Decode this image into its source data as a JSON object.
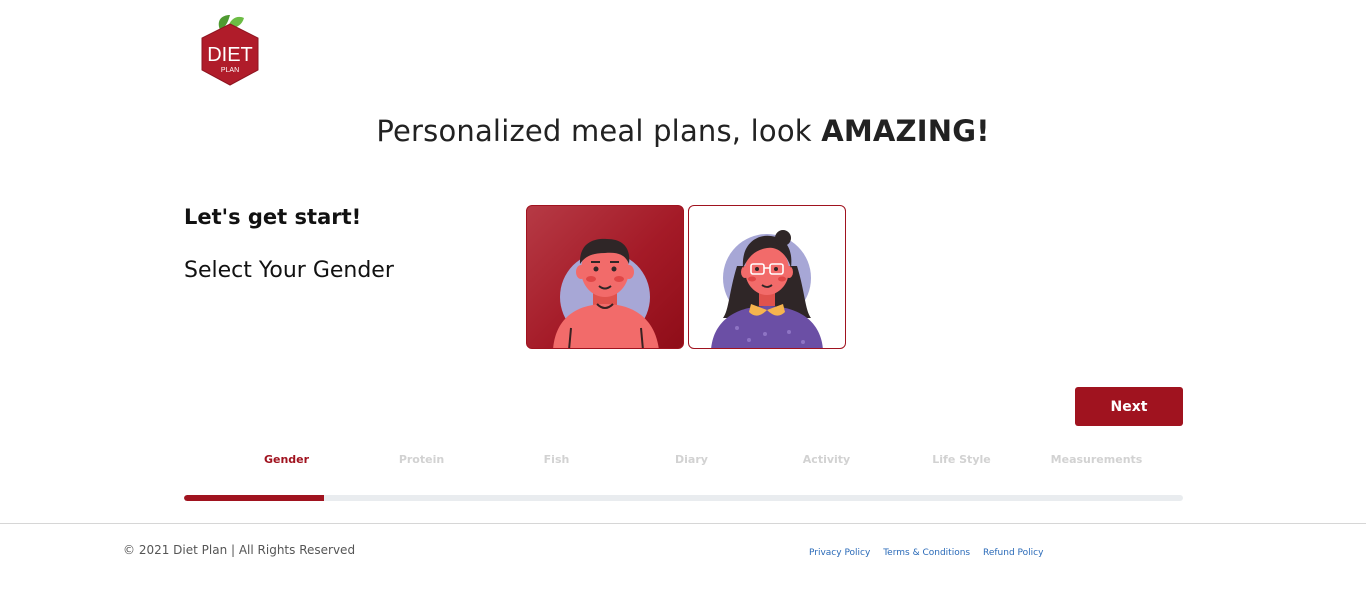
{
  "brand": {
    "logo_line1": "DIET",
    "logo_line2": "PLAN",
    "logo_color": "#b01c2a",
    "leaf_color": "#5cab3a"
  },
  "hero": {
    "title_regular": "Personalized meal plans, look ",
    "title_bold": "AMAZING!"
  },
  "intro": {
    "lead": "Let's get start!",
    "prompt": "Select Your Gender"
  },
  "gender_options": [
    {
      "id": "male",
      "avatar_icon": "male-avatar-icon",
      "selected": true
    },
    {
      "id": "female",
      "avatar_icon": "female-avatar-icon",
      "selected": false
    }
  ],
  "next_button": "Next",
  "steps": [
    {
      "label": "Gender",
      "active": true
    },
    {
      "label": "Protein",
      "active": false
    },
    {
      "label": "Fish",
      "active": false
    },
    {
      "label": "Diary",
      "active": false
    },
    {
      "label": "Activity",
      "active": false
    },
    {
      "label": "Life Style",
      "active": false
    },
    {
      "label": "Measurements",
      "active": false
    }
  ],
  "progress": {
    "current_step": 1,
    "total_steps": 7,
    "fraction": 0.14
  },
  "footer": {
    "copyright": "© 2021 Diet Plan | All Rights Reserved",
    "links": [
      "Privacy Policy",
      "Terms & Conditions",
      "Refund Policy"
    ]
  },
  "colors": {
    "accent": "#a0131f",
    "inactive_step": "#d2d2d2",
    "link": "#2a6ab8"
  }
}
